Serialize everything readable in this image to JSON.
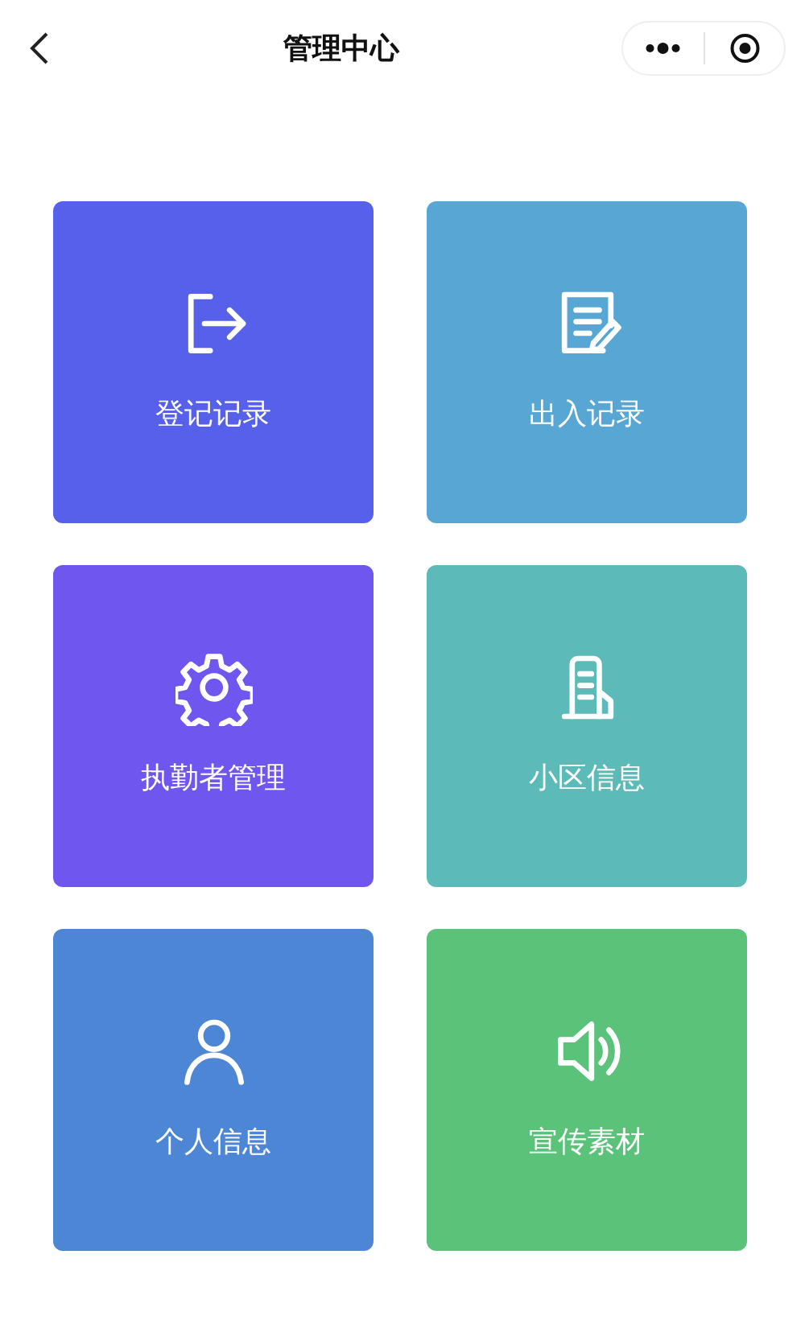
{
  "nav": {
    "title": "管理中心"
  },
  "tiles": [
    {
      "label": "登记记录",
      "kind": "exit",
      "color": "#5660ea"
    },
    {
      "label": "出入记录",
      "kind": "document",
      "color": "#57a6d4"
    },
    {
      "label": "执勤者管理",
      "kind": "gear",
      "color": "#6e56ee"
    },
    {
      "label": "小区信息",
      "kind": "building",
      "color": "#5cbab8"
    },
    {
      "label": "个人信息",
      "kind": "person",
      "color": "#4e86d6"
    },
    {
      "label": "宣传素材",
      "kind": "speaker",
      "color": "#5bc27a"
    }
  ]
}
